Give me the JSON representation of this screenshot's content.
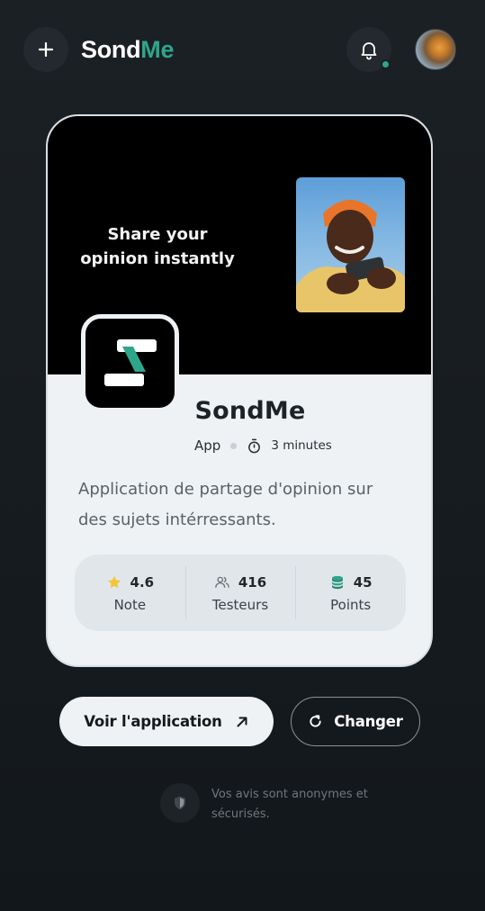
{
  "header": {
    "logo_part1": "Sond",
    "logo_part2": "Me",
    "accent_color": "#2fa58b",
    "add_icon": "plus-icon",
    "notification_icon": "bell-icon",
    "has_notification": true
  },
  "card": {
    "banner_text": "Share your opinion instantly",
    "app_name": "SondMe",
    "type": "App",
    "duration": "3 minutes",
    "description": "Application de partage d'opinion sur des sujets intérressants.",
    "stats": [
      {
        "icon": "star-icon",
        "value": "4.6",
        "label": "Note"
      },
      {
        "icon": "users-icon",
        "value": "416",
        "label": "Testeurs"
      },
      {
        "icon": "coins-icon",
        "value": "45",
        "label": "Points"
      }
    ]
  },
  "actions": {
    "view_label": "Voir l'application",
    "view_icon": "arrow-up-right-icon",
    "change_label": "Changer",
    "change_icon": "refresh-icon"
  },
  "footer": {
    "secure_icon": "shield-icon",
    "secure_text": "Vos avis sont anonymes et sécurisés."
  }
}
